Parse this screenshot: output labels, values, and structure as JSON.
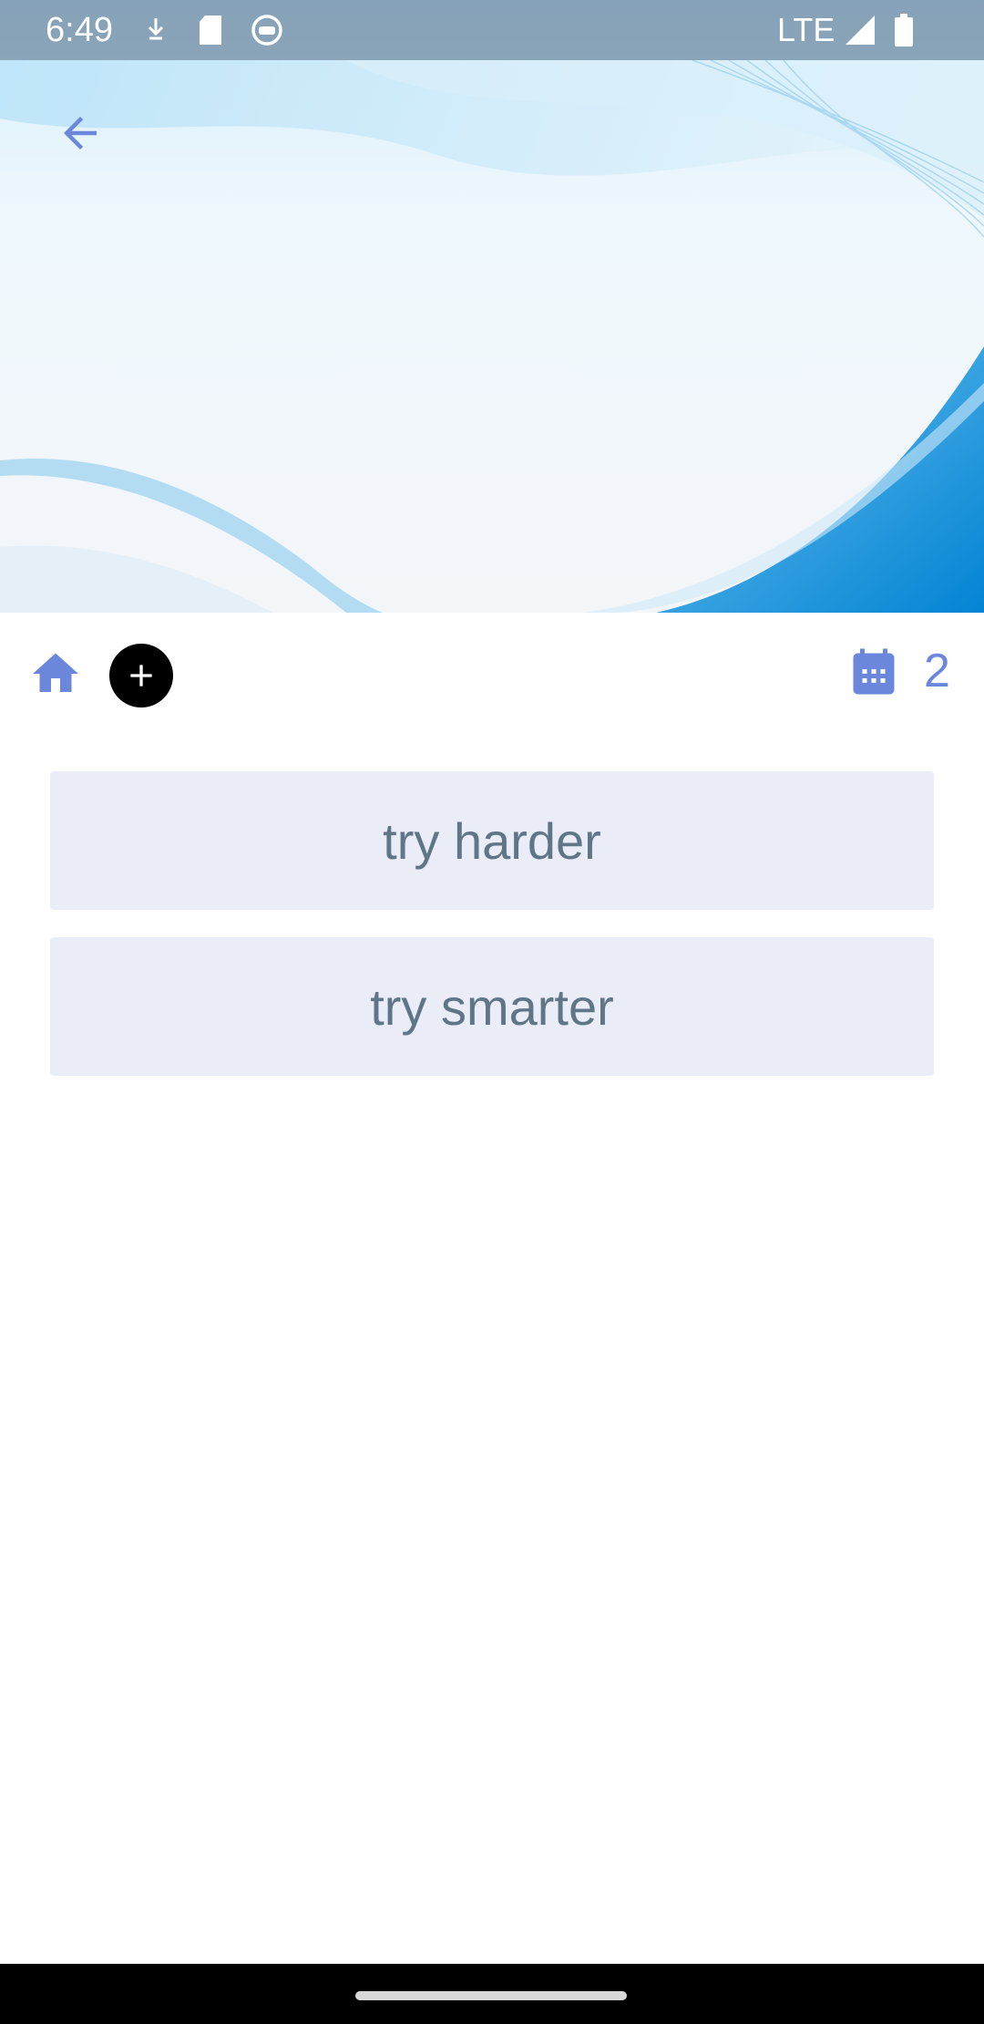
{
  "status_bar": {
    "time": "6:49",
    "network": "LTE",
    "icons": [
      "download-icon",
      "sd-card-icon",
      "robot-face-icon",
      "signal-icon",
      "battery-icon"
    ]
  },
  "header": {
    "back_icon": "arrow-left-icon",
    "accent_color": "#6b87dc"
  },
  "toolbar": {
    "home_icon": "home-icon",
    "add_icon": "plus-circle-icon",
    "calendar_icon": "calendar-icon",
    "calendar_count": "2"
  },
  "list": {
    "items": [
      {
        "label": "try harder"
      },
      {
        "label": "try smarter"
      }
    ]
  },
  "colors": {
    "item_background": "#eaedf7",
    "item_text": "#5f7687",
    "banner_blue": "#0a8fd6"
  }
}
